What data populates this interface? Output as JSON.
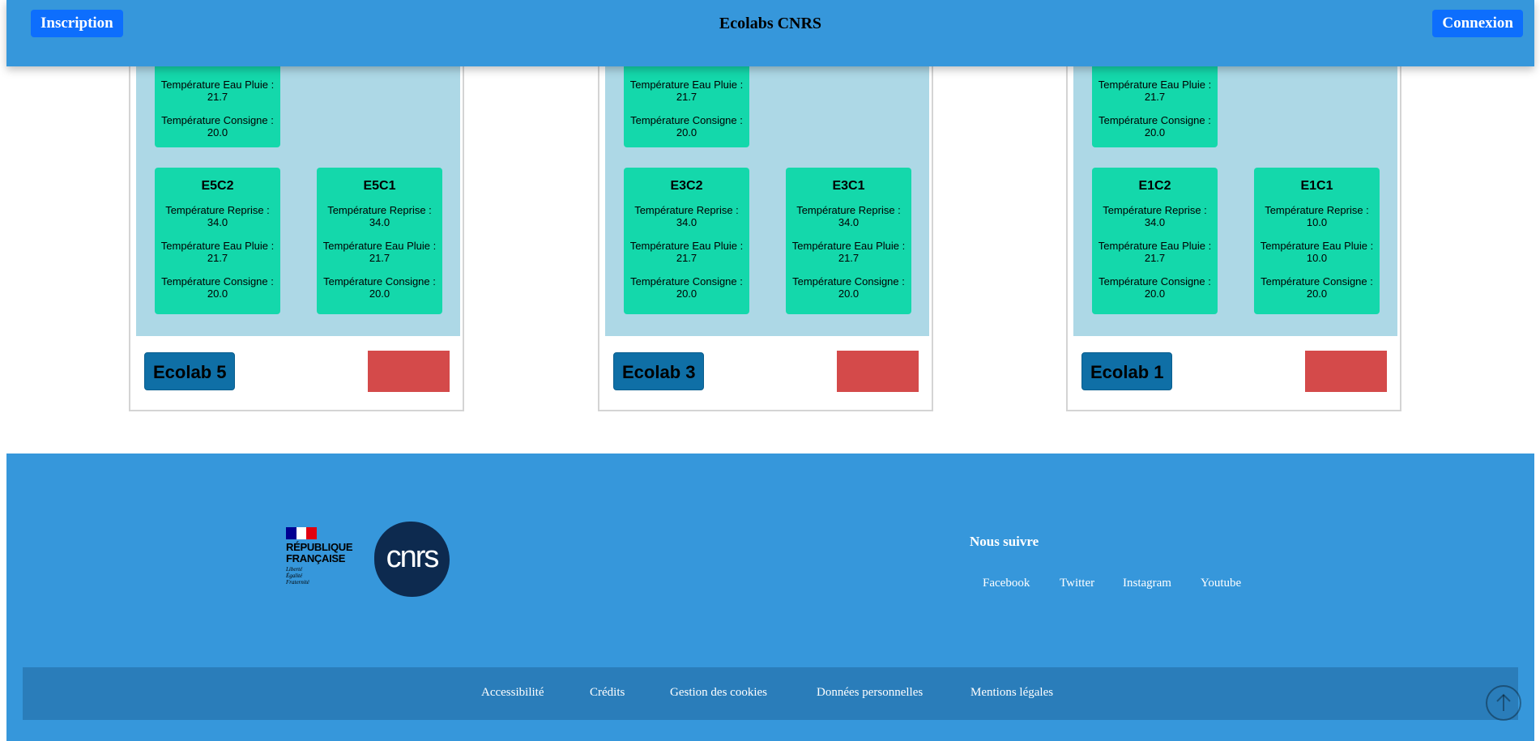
{
  "header": {
    "title": "Ecolabs CNRS",
    "inscription_label": "Inscription",
    "connexion_label": "Connexion"
  },
  "ecolabs": [
    {
      "label": "Ecolab 5",
      "top_room": {
        "lines": [
          "Température Eau Pluie :",
          "21.7",
          "Température Consigne :",
          "20.0"
        ]
      },
      "rooms": [
        {
          "name": "E5C2",
          "reprise_label": "Température Reprise :",
          "reprise": "34.0",
          "pluie_label": "Température Eau Pluie :",
          "pluie": "21.7",
          "consigne_label": "Température Consigne :",
          "consigne": "20.0"
        },
        {
          "name": "E5C1",
          "reprise_label": "Température Reprise :",
          "reprise": "34.0",
          "pluie_label": "Température Eau Pluie :",
          "pluie": "21.7",
          "consigne_label": "Température Consigne :",
          "consigne": "20.0"
        }
      ]
    },
    {
      "label": "Ecolab 3",
      "top_room": {
        "lines": [
          "Température Eau Pluie :",
          "21.7",
          "Température Consigne :",
          "20.0"
        ]
      },
      "rooms": [
        {
          "name": "E3C2",
          "reprise_label": "Température Reprise :",
          "reprise": "34.0",
          "pluie_label": "Température Eau Pluie :",
          "pluie": "21.7",
          "consigne_label": "Température Consigne :",
          "consigne": "20.0"
        },
        {
          "name": "E3C1",
          "reprise_label": "Température Reprise :",
          "reprise": "34.0",
          "pluie_label": "Température Eau Pluie :",
          "pluie": "21.7",
          "consigne_label": "Température Consigne :",
          "consigne": "20.0"
        }
      ]
    },
    {
      "label": "Ecolab 1",
      "top_room": {
        "lines": [
          "Température Eau Pluie :",
          "21.7",
          "Température Consigne :",
          "20.0"
        ]
      },
      "rooms": [
        {
          "name": "E1C2",
          "reprise_label": "Température Reprise :",
          "reprise": "34.0",
          "pluie_label": "Température Eau Pluie :",
          "pluie": "21.7",
          "consigne_label": "Température Consigne :",
          "consigne": "20.0"
        },
        {
          "name": "E1C1",
          "reprise_label": "Température Reprise :",
          "reprise": "10.0",
          "pluie_label": "Température Eau Pluie :",
          "pluie": "10.0",
          "consigne_label": "Température Consigne :",
          "consigne": "20.0"
        }
      ]
    }
  ],
  "footer": {
    "rf_logo": {
      "line1": "RÉPUBLIQUE",
      "line2": "FRANÇAISE",
      "motto1": "Liberté",
      "motto2": "Égalité",
      "motto3": "Fraternité",
      "flag_colors": [
        "#000091",
        "#ffffff",
        "#e1000f"
      ]
    },
    "cnrs_logo": "cnrs",
    "follow_title": "Nous suivre",
    "social": [
      "Facebook",
      "Twitter",
      "Instagram",
      "Youtube"
    ],
    "legal": [
      "Accessibilité",
      "Crédits",
      "Gestion des cookies",
      "Données personnelles",
      "Mentions légales"
    ]
  },
  "colors": {
    "header_bg": "#3697db",
    "primary_button": "#0d6efd",
    "card_inner": "#add8e6",
    "room_bg": "#14d8ab",
    "ecolab_button": "#0f6fa6",
    "delete_button": "#d44a4a",
    "legal_bar": "#2a7dba"
  },
  "icons": {
    "scroll_top": "arrow-up-circle-icon"
  }
}
